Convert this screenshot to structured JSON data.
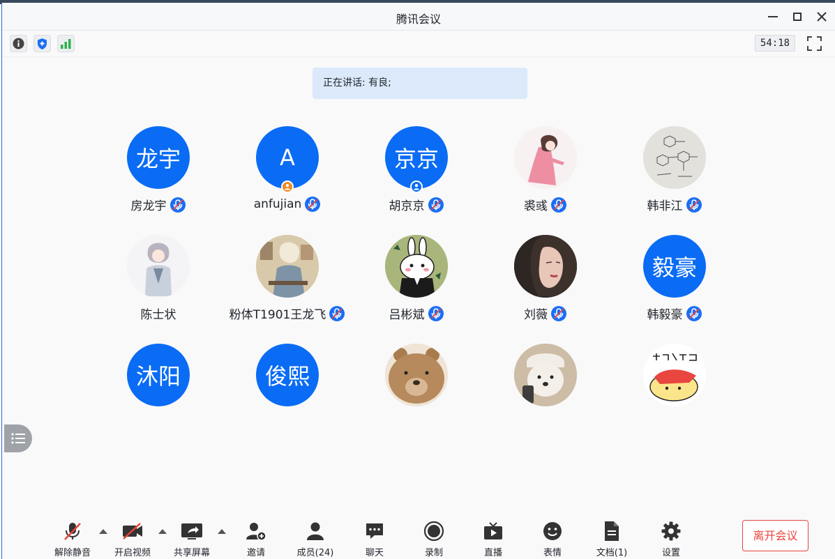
{
  "window": {
    "title": "腾讯会议"
  },
  "infobar": {
    "timer": "54:18"
  },
  "speaking": {
    "text": "正在讲话: 有良;"
  },
  "participants": [
    {
      "name": "房龙宇",
      "avatar_text": "龙宇",
      "muted": true
    },
    {
      "name": "anfujian",
      "avatar_text": "A",
      "muted": true
    },
    {
      "name": "胡京京",
      "avatar_text": "京京",
      "muted": true
    },
    {
      "name": "裘彧",
      "avatar_text": "",
      "muted": true
    },
    {
      "name": "韩非江",
      "avatar_text": "",
      "muted": true
    },
    {
      "name": "陈士状",
      "avatar_text": "",
      "muted": false
    },
    {
      "name": "粉体T1901王龙飞",
      "avatar_text": "",
      "muted": true
    },
    {
      "name": "吕彬斌",
      "avatar_text": "",
      "muted": true
    },
    {
      "name": "刘薇",
      "avatar_text": "",
      "muted": true
    },
    {
      "name": "韩毅豪",
      "avatar_text": "毅豪",
      "muted": true
    },
    {
      "name": "",
      "avatar_text": "沐阳",
      "muted": false
    },
    {
      "name": "",
      "avatar_text": "俊熙",
      "muted": false
    },
    {
      "name": "",
      "avatar_text": "",
      "muted": false
    },
    {
      "name": "",
      "avatar_text": "",
      "muted": false
    },
    {
      "name": "",
      "avatar_text": "",
      "muted": false
    }
  ],
  "toolbar": {
    "unmute": "解除静音",
    "video": "开启视频",
    "share": "共享屏幕",
    "invite": "邀请",
    "members": "成员(24)",
    "chat": "聊天",
    "record": "录制",
    "live": "直播",
    "emoji": "表情",
    "docs": "文档(1)",
    "settings": "设置",
    "leave": "离开会议"
  },
  "colors": {
    "accent": "#0a6cf5",
    "danger": "#e8443a",
    "speaking_bg": "#dbe9fb"
  }
}
